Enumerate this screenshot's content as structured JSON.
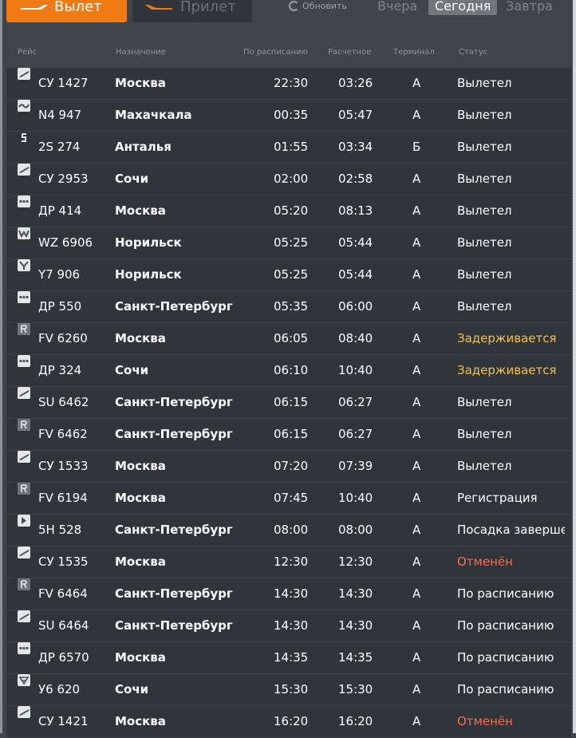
{
  "tabs": {
    "departure": "Вылет",
    "arrival": "Прилет"
  },
  "refresh_label": "Обновить",
  "days": {
    "yesterday": "Вчера",
    "today": "Сегодня",
    "tomorrow": "Завтра"
  },
  "columns": {
    "flight": "Рейс",
    "destination": "Назначение",
    "scheduled": "По расписанию",
    "estimated": "Расчетное",
    "terminal": "Терминал",
    "status": "Статус"
  },
  "status_colors": {
    "normal": "#ffffff",
    "delayed": "#f2c14a",
    "cancelled": "#f0705a"
  },
  "flights": [
    {
      "logo": "airline-wing-icon",
      "flight": "СУ 1427",
      "destination": "Москва",
      "scheduled": "22:30",
      "estimated": "03:26",
      "terminal": "A",
      "status": "Вылетел",
      "status_type": "normal"
    },
    {
      "logo": "airline-wave-icon",
      "flight": "N4 947",
      "destination": "Махачкала",
      "scheduled": "00:35",
      "estimated": "05:47",
      "terminal": "A",
      "status": "Вылетел",
      "status_type": "normal"
    },
    {
      "logo": "airline-s7-icon",
      "flight": "2S 274",
      "destination": "Анталья",
      "scheduled": "01:55",
      "estimated": "03:34",
      "terminal": "Б",
      "status": "Вылетел",
      "status_type": "normal"
    },
    {
      "logo": "airline-wing-icon",
      "flight": "СУ 2953",
      "destination": "Сочи",
      "scheduled": "02:00",
      "estimated": "02:58",
      "terminal": "A",
      "status": "Вылетел",
      "status_type": "normal"
    },
    {
      "logo": "airline-dots-icon",
      "flight": "ДР 414",
      "destination": "Москва",
      "scheduled": "05:20",
      "estimated": "08:13",
      "terminal": "A",
      "status": "Вылетел",
      "status_type": "normal"
    },
    {
      "logo": "airline-wz-icon",
      "flight": "WZ 6906",
      "destination": "Норильск",
      "scheduled": "05:25",
      "estimated": "05:44",
      "terminal": "A",
      "status": "Вылетел",
      "status_type": "normal"
    },
    {
      "logo": "airline-bird-icon",
      "flight": "Y7 906",
      "destination": "Норильск",
      "scheduled": "05:25",
      "estimated": "05:44",
      "terminal": "A",
      "status": "Вылетел",
      "status_type": "normal"
    },
    {
      "logo": "airline-dots-icon",
      "flight": "ДР 550",
      "destination": "Санкт-Петербург",
      "scheduled": "05:35",
      "estimated": "06:00",
      "terminal": "A",
      "status": "Вылетел",
      "status_type": "normal"
    },
    {
      "logo": "airline-r-icon",
      "flight": "FV 6260",
      "destination": "Москва",
      "scheduled": "06:05",
      "estimated": "08:40",
      "terminal": "A",
      "status": "Задерживается",
      "status_type": "delayed"
    },
    {
      "logo": "airline-dots-icon",
      "flight": "ДР 324",
      "destination": "Сочи",
      "scheduled": "06:10",
      "estimated": "10:40",
      "terminal": "A",
      "status": "Задерживается",
      "status_type": "delayed"
    },
    {
      "logo": "airline-wing-icon",
      "flight": "SU 6462",
      "destination": "Санкт-Петербург",
      "scheduled": "06:15",
      "estimated": "06:27",
      "terminal": "A",
      "status": "Вылетел",
      "status_type": "normal"
    },
    {
      "logo": "airline-r-icon",
      "flight": "FV 6462",
      "destination": "Санкт-Петербург",
      "scheduled": "06:15",
      "estimated": "06:27",
      "terminal": "A",
      "status": "Вылетел",
      "status_type": "normal"
    },
    {
      "logo": "airline-wing-icon",
      "flight": "СУ 1533",
      "destination": "Москва",
      "scheduled": "07:20",
      "estimated": "07:39",
      "terminal": "A",
      "status": "Вылетел",
      "status_type": "normal"
    },
    {
      "logo": "airline-r-icon",
      "flight": "FV 6194",
      "destination": "Москва",
      "scheduled": "07:45",
      "estimated": "10:40",
      "terminal": "A",
      "status": "Регистрация",
      "status_type": "normal"
    },
    {
      "logo": "airline-5h-icon",
      "flight": "5H 528",
      "destination": "Санкт-Петербург",
      "scheduled": "08:00",
      "estimated": "08:00",
      "terminal": "A",
      "status": "Посадка завершен",
      "status_type": "normal"
    },
    {
      "logo": "airline-wing-icon",
      "flight": "СУ 1535",
      "destination": "Москва",
      "scheduled": "12:30",
      "estimated": "12:30",
      "terminal": "A",
      "status": "Отменён",
      "status_type": "cancelled"
    },
    {
      "logo": "airline-r-icon",
      "flight": "FV 6464",
      "destination": "Санкт-Петербург",
      "scheduled": "14:30",
      "estimated": "14:30",
      "terminal": "A",
      "status": "По расписанию",
      "status_type": "normal"
    },
    {
      "logo": "airline-wing-icon",
      "flight": "SU 6464",
      "destination": "Санкт-Петербург",
      "scheduled": "14:30",
      "estimated": "14:30",
      "terminal": "A",
      "status": "По расписанию",
      "status_type": "normal"
    },
    {
      "logo": "airline-dots-icon",
      "flight": "ДР 6570",
      "destination": "Москва",
      "scheduled": "14:35",
      "estimated": "14:35",
      "terminal": "A",
      "status": "По расписанию",
      "status_type": "normal"
    },
    {
      "logo": "airline-y6-icon",
      "flight": "У6 620",
      "destination": "Сочи",
      "scheduled": "15:30",
      "estimated": "15:30",
      "terminal": "A",
      "status": "По расписанию",
      "status_type": "normal"
    },
    {
      "logo": "airline-wing-icon",
      "flight": "СУ 1421",
      "destination": "Москва",
      "scheduled": "16:20",
      "estimated": "16:20",
      "terminal": "A",
      "status": "Отменён",
      "status_type": "cancelled"
    }
  ]
}
